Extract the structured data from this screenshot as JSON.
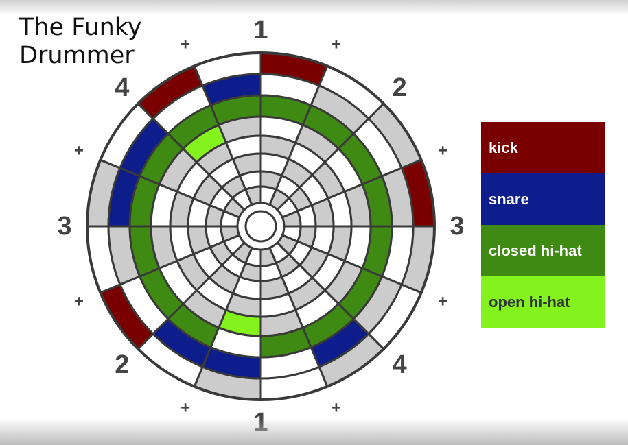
{
  "title": "The Funky\nDrummer",
  "colors": {
    "kick": "#7a0000",
    "snare": "#0e1d8c",
    "closed_hihat": "#3f8a12",
    "open_hihat": "#84f21c",
    "grey": "#cccccc",
    "white": "#ffffff",
    "line": "#3a3a3a"
  },
  "legend": [
    {
      "label": "kick",
      "color": "#7a0000"
    },
    {
      "label": "snare",
      "color": "#0e1d8c"
    },
    {
      "label": "closed hi-hat",
      "color": "#3f8a12"
    },
    {
      "label": "open hi-hat",
      "color": "#84f21c"
    }
  ],
  "beat_labels": [
    "1",
    "+",
    "2",
    "+",
    "3",
    "+",
    "4",
    "+",
    "1",
    "+",
    "2",
    "+",
    "3",
    "+",
    "4",
    "+"
  ],
  "rings": [
    {
      "name": "kick",
      "pattern": [
        "kick",
        "white",
        "grey",
        "kick",
        "grey",
        "white",
        "grey",
        "white",
        "grey",
        "white",
        "kick",
        "white",
        "grey",
        "white",
        "kick",
        "white"
      ]
    },
    {
      "name": "snare",
      "pattern": [
        "white",
        "grey",
        "white",
        "grey",
        "white",
        "grey",
        "snare",
        "white",
        "snare",
        "snare",
        "white",
        "grey",
        "snare",
        "snare",
        "white",
        "snare"
      ]
    },
    {
      "name": "closed-hihat",
      "pattern": [
        "closed_hihat",
        "closed_hihat",
        "closed_hihat",
        "closed_hihat",
        "closed_hihat",
        "closed_hihat",
        "closed_hihat",
        "closed_hihat",
        "white",
        "closed_hihat",
        "closed_hihat",
        "closed_hihat",
        "closed_hihat",
        "closed_hihat",
        "closed_hihat",
        "closed_hihat"
      ]
    },
    {
      "name": "open-hihat",
      "pattern": [
        "white",
        "grey",
        "white",
        "grey",
        "white",
        "grey",
        "white",
        "grey",
        "open_hihat",
        "grey",
        "white",
        "grey",
        "white",
        "grey",
        "open_hihat",
        "grey"
      ]
    },
    {
      "name": "inner-1",
      "pattern": [
        "grey",
        "white",
        "grey",
        "white",
        "grey",
        "white",
        "grey",
        "white",
        "grey",
        "white",
        "grey",
        "white",
        "grey",
        "white",
        "grey",
        "white"
      ]
    },
    {
      "name": "inner-2",
      "pattern": [
        "white",
        "grey",
        "white",
        "grey",
        "white",
        "grey",
        "white",
        "grey",
        "white",
        "grey",
        "white",
        "grey",
        "white",
        "grey",
        "white",
        "grey"
      ]
    },
    {
      "name": "inner-3",
      "pattern": [
        "grey",
        "white",
        "grey",
        "white",
        "grey",
        "white",
        "grey",
        "white",
        "grey",
        "white",
        "grey",
        "white",
        "grey",
        "white",
        "grey",
        "white"
      ]
    },
    {
      "name": "inner-4",
      "pattern": [
        "white",
        "grey",
        "white",
        "grey",
        "white",
        "grey",
        "white",
        "grey",
        "white",
        "grey",
        "white",
        "grey",
        "white",
        "grey",
        "white",
        "grey"
      ]
    }
  ]
}
